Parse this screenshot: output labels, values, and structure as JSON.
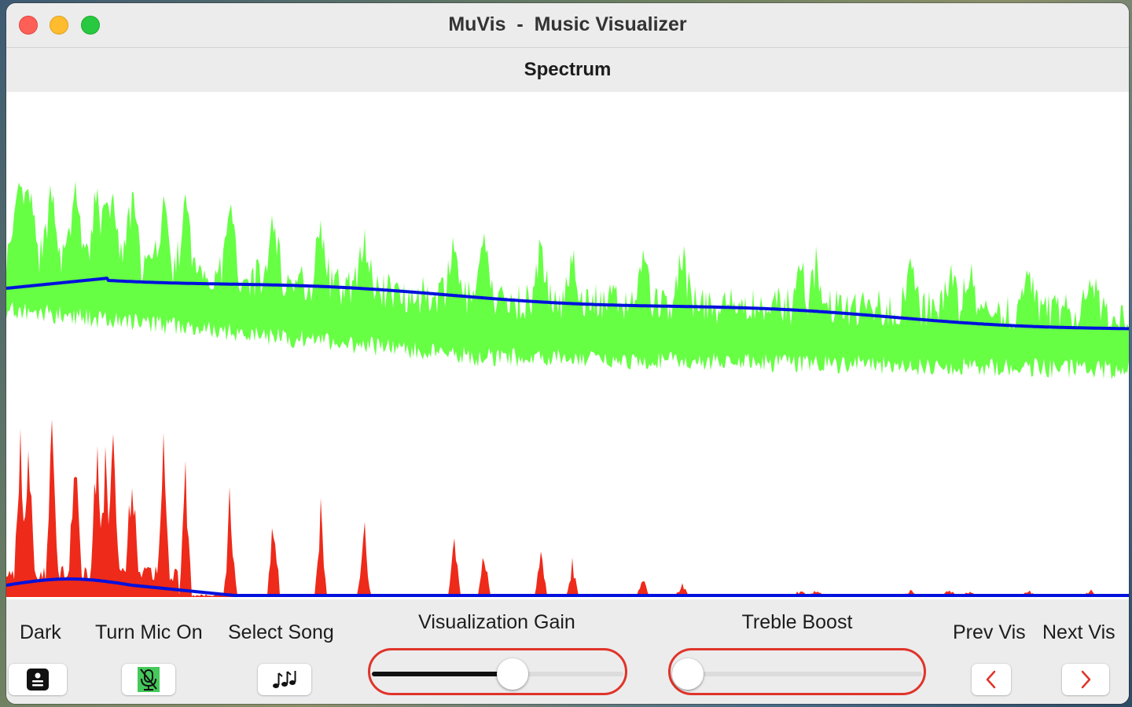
{
  "window": {
    "title": "MuVis  -  Music Visualizer",
    "subtitle": "Spectrum"
  },
  "controls": {
    "dark_label": "Dark",
    "mic_label": "Turn Mic On",
    "song_label": "Select Song",
    "gain_label": "Visualization Gain",
    "treble_label": "Treble Boost",
    "prev_label": "Prev Vis",
    "next_label": "Next Vis"
  },
  "icons": {
    "dark": "display-settings-icon",
    "mic": "mic-slash-icon",
    "song": "music-notes-icon",
    "prev": "chevron-left-icon",
    "next": "chevron-right-icon"
  },
  "sliders": {
    "visualization_gain": 0.56,
    "treble_boost": 0.0
  },
  "colors": {
    "upper_spectrum": "#66ff44",
    "lower_spectrum": "#ee2a1a",
    "mean_line": "#0011dd",
    "slider_outline": "#e0342a",
    "mic_badge": "#44c95a",
    "chevron": "#e0342a"
  }
}
